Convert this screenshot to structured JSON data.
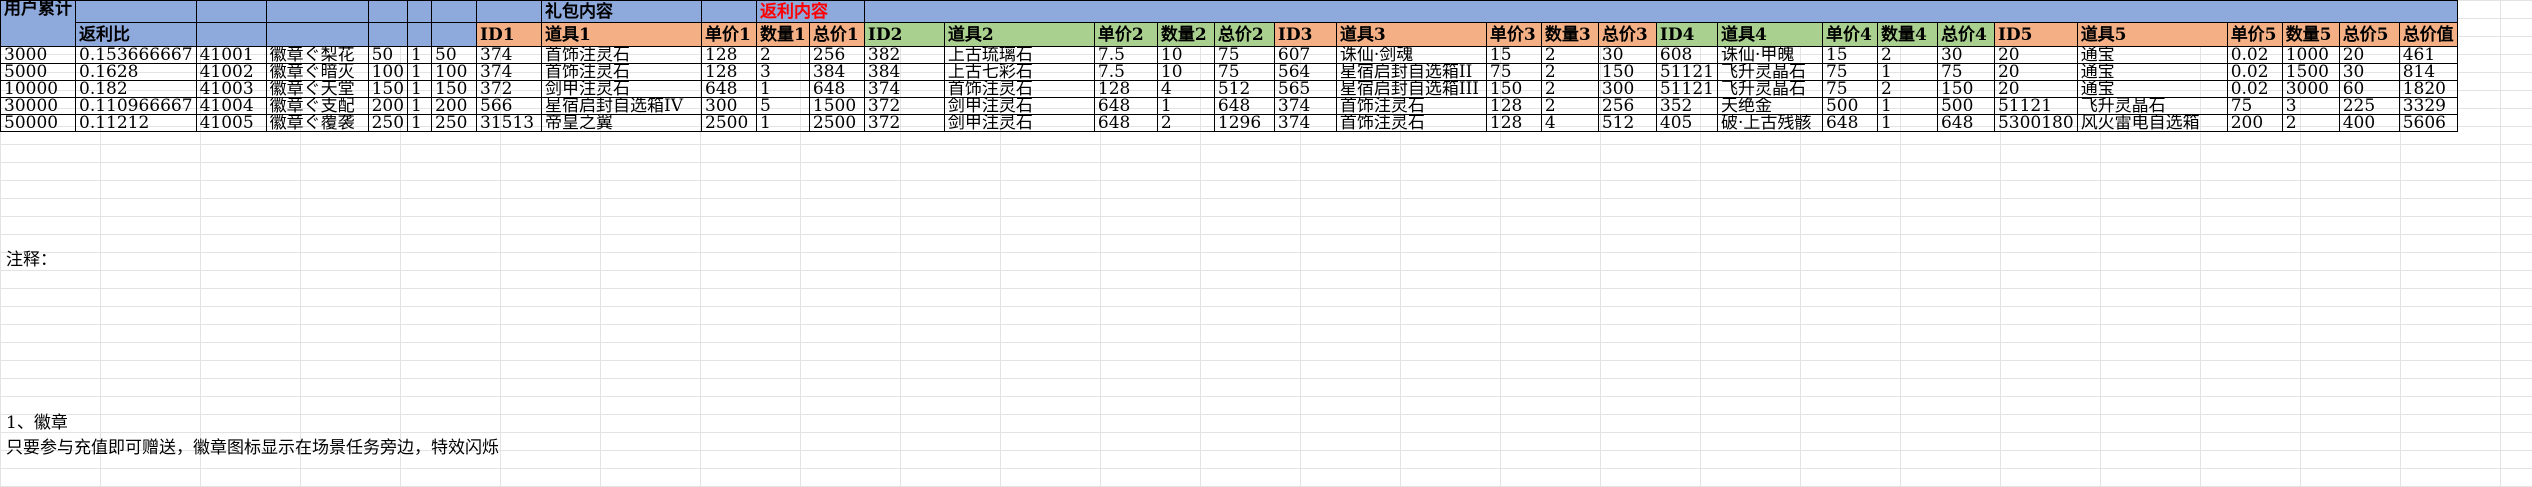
{
  "header": {
    "col_a": "用户累计",
    "col_b": "返利比",
    "gift_section": "礼包内容",
    "rebate_section": "返利内容",
    "cols": [
      "ID1",
      "道具1",
      "单价1",
      "数量1",
      "总价1",
      "ID2",
      "道具2",
      "单价2",
      "数量2",
      "总价2",
      "ID3",
      "道具3",
      "单价3",
      "数量3",
      "总价3",
      "ID4",
      "道具4",
      "单价4",
      "数量4",
      "总价4",
      "ID5",
      "道具5",
      "单价5",
      "数量5",
      "总价5",
      "总价值"
    ]
  },
  "rows": [
    [
      "3000",
      "0.153666667",
      "41001",
      "徽章ぐ梨花",
      "50",
      "1",
      "50",
      "374",
      "首饰注灵石",
      "128",
      "2",
      "256",
      "382",
      "上古琉璃石",
      "7.5",
      "10",
      "75",
      "607",
      "诛仙·剑魂",
      "15",
      "2",
      "30",
      "608",
      "诛仙·甲魄",
      "15",
      "2",
      "30",
      "20",
      "通宝",
      "0.02",
      "1000",
      "20",
      "461"
    ],
    [
      "5000",
      "0.1628",
      "41002",
      "徽章ぐ暗灭",
      "100",
      "1",
      "100",
      "374",
      "首饰注灵石",
      "128",
      "3",
      "384",
      "384",
      "上古七彩石",
      "7.5",
      "10",
      "75",
      "564",
      "星宿启封自选箱II",
      "75",
      "2",
      "150",
      "51121",
      "飞升灵晶石",
      "75",
      "1",
      "75",
      "20",
      "通宝",
      "0.02",
      "1500",
      "30",
      "814"
    ],
    [
      "10000",
      "0.182",
      "41003",
      "徽章ぐ天堂",
      "150",
      "1",
      "150",
      "372",
      "剑甲注灵石",
      "648",
      "1",
      "648",
      "374",
      "首饰注灵石",
      "128",
      "4",
      "512",
      "565",
      "星宿启封自选箱III",
      "150",
      "2",
      "300",
      "51121",
      "飞升灵晶石",
      "75",
      "2",
      "150",
      "20",
      "通宝",
      "0.02",
      "3000",
      "60",
      "1820"
    ],
    [
      "30000",
      "0.110966667",
      "41004",
      "徽章ぐ支配",
      "200",
      "1",
      "200",
      "566",
      "星宿启封自选箱IV",
      "300",
      "5",
      "1500",
      "372",
      "剑甲注灵石",
      "648",
      "1",
      "648",
      "374",
      "首饰注灵石",
      "128",
      "2",
      "256",
      "352",
      "天绝金",
      "500",
      "1",
      "500",
      "51121",
      "飞升灵晶石",
      "75",
      "3",
      "225",
      "3329"
    ],
    [
      "50000",
      "0.11212",
      "41005",
      "徽章ぐ覆袭",
      "250",
      "1",
      "250",
      "31513",
      "帝皇之翼",
      "2500",
      "1",
      "2500",
      "372",
      "剑甲注灵石",
      "648",
      "2",
      "1296",
      "374",
      "首饰注灵石",
      "128",
      "4",
      "512",
      "405",
      "破·上古残骸",
      "648",
      "1",
      "648",
      "5300180",
      "风火雷电自选箱",
      "200",
      "2",
      "400",
      "5606"
    ]
  ],
  "notes": {
    "label": "注释：",
    "title": "1、徽章",
    "body": "只要参与充值即可赠送，徽章图标显示在场景任务旁边，特效闪烁"
  }
}
